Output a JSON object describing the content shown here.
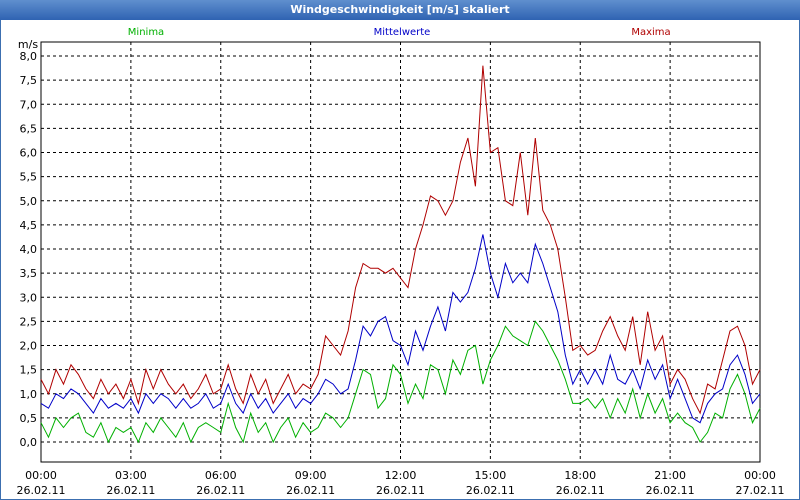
{
  "window": {
    "title": "Windgeschwindigkeit [m/s] skaliert"
  },
  "chart_data": {
    "type": "line",
    "title": "Windgeschwindigkeit [m/s] skaliert",
    "ylabel": "m/s",
    "ylim": [
      0,
      8
    ],
    "grid": true,
    "legend_position": "top",
    "y_ticks": [
      "0,0",
      "0,5",
      "1,0",
      "1,5",
      "2,0",
      "2,5",
      "3,0",
      "3,5",
      "4,0",
      "4,5",
      "5,0",
      "5,5",
      "6,0",
      "6,5",
      "7,0",
      "7,5",
      "8,0"
    ],
    "x_ticks": [
      {
        "time": "00:00",
        "date": "26.02.11"
      },
      {
        "time": "03:00",
        "date": "26.02.11"
      },
      {
        "time": "06:00",
        "date": "26.02.11"
      },
      {
        "time": "09:00",
        "date": "26.02.11"
      },
      {
        "time": "12:00",
        "date": "26.02.11"
      },
      {
        "time": "15:00",
        "date": "26.02.11"
      },
      {
        "time": "18:00",
        "date": "26.02.11"
      },
      {
        "time": "21:00",
        "date": "26.02.11"
      },
      {
        "time": "00:00",
        "date": "27.02.11"
      }
    ],
    "x_hours": [
      0,
      0.25,
      0.5,
      0.75,
      1,
      1.25,
      1.5,
      1.75,
      2,
      2.25,
      2.5,
      2.75,
      3,
      3.25,
      3.5,
      3.75,
      4,
      4.25,
      4.5,
      4.75,
      5,
      5.25,
      5.5,
      5.75,
      6,
      6.25,
      6.5,
      6.75,
      7,
      7.25,
      7.5,
      7.75,
      8,
      8.25,
      8.5,
      8.75,
      9,
      9.25,
      9.5,
      9.75,
      10,
      10.25,
      10.5,
      10.75,
      11,
      11.25,
      11.5,
      11.75,
      12,
      12.25,
      12.5,
      12.75,
      13,
      13.25,
      13.5,
      13.75,
      14,
      14.25,
      14.5,
      14.75,
      15,
      15.25,
      15.5,
      15.75,
      16,
      16.25,
      16.5,
      16.75,
      17,
      17.25,
      17.5,
      17.75,
      18,
      18.25,
      18.5,
      18.75,
      19,
      19.25,
      19.5,
      19.75,
      20,
      20.25,
      20.5,
      20.75,
      21,
      21.25,
      21.5,
      21.75,
      22,
      22.25,
      22.5,
      22.75,
      23,
      23.25,
      23.5,
      23.75,
      24
    ],
    "series": [
      {
        "name": "Minima",
        "color": "#00b000",
        "values": [
          0.4,
          0.1,
          0.5,
          0.3,
          0.5,
          0.6,
          0.2,
          0.1,
          0.4,
          0.0,
          0.3,
          0.2,
          0.3,
          0.0,
          0.4,
          0.2,
          0.5,
          0.3,
          0.1,
          0.4,
          0.0,
          0.3,
          0.4,
          0.3,
          0.2,
          0.8,
          0.3,
          0.0,
          0.6,
          0.2,
          0.4,
          0.0,
          0.3,
          0.5,
          0.1,
          0.4,
          0.2,
          0.3,
          0.6,
          0.5,
          0.3,
          0.5,
          1.0,
          1.5,
          1.4,
          0.7,
          0.9,
          1.6,
          1.4,
          0.8,
          1.2,
          0.9,
          1.6,
          1.5,
          1.0,
          1.7,
          1.4,
          1.9,
          2.0,
          1.2,
          1.7,
          2.0,
          2.4,
          2.2,
          2.1,
          2.0,
          2.5,
          2.3,
          2.0,
          1.7,
          1.3,
          0.8,
          0.8,
          0.9,
          0.7,
          0.9,
          0.5,
          0.9,
          0.6,
          1.1,
          0.5,
          1.0,
          0.6,
          0.9,
          0.4,
          0.6,
          0.4,
          0.3,
          0.0,
          0.2,
          0.6,
          0.5,
          1.1,
          1.4,
          1.0,
          0.4,
          0.7,
          0.5,
          0.5
        ]
      },
      {
        "name": "Mittelwerte",
        "color": "#0000c8",
        "values": [
          0.8,
          0.7,
          1.0,
          0.9,
          1.1,
          1.0,
          0.8,
          0.6,
          0.9,
          0.7,
          0.8,
          0.7,
          0.9,
          0.6,
          1.0,
          0.8,
          1.0,
          0.9,
          0.7,
          0.9,
          0.7,
          0.8,
          1.0,
          0.7,
          0.8,
          1.2,
          0.8,
          0.6,
          1.0,
          0.7,
          0.9,
          0.6,
          0.8,
          1.0,
          0.7,
          0.9,
          0.8,
          1.0,
          1.3,
          1.2,
          1.0,
          1.1,
          1.7,
          2.4,
          2.2,
          2.5,
          2.6,
          2.1,
          2.0,
          1.6,
          2.3,
          1.9,
          2.4,
          2.8,
          2.3,
          3.1,
          2.9,
          3.1,
          3.6,
          4.3,
          3.5,
          3.0,
          3.7,
          3.3,
          3.5,
          3.3,
          4.1,
          3.7,
          3.2,
          2.7,
          1.8,
          1.2,
          1.5,
          1.2,
          1.5,
          1.2,
          1.8,
          1.3,
          1.2,
          1.5,
          1.1,
          1.7,
          1.3,
          1.6,
          0.9,
          1.3,
          0.9,
          0.5,
          0.4,
          0.8,
          1.0,
          1.1,
          1.6,
          1.8,
          1.4,
          0.8,
          1.0,
          0.7,
          1.1
        ]
      },
      {
        "name": "Maxima",
        "color": "#b00000",
        "values": [
          1.3,
          1.0,
          1.5,
          1.2,
          1.6,
          1.4,
          1.1,
          0.9,
          1.3,
          1.0,
          1.2,
          0.9,
          1.3,
          0.8,
          1.5,
          1.1,
          1.5,
          1.2,
          1.0,
          1.2,
          0.9,
          1.1,
          1.4,
          1.0,
          1.1,
          1.6,
          1.1,
          0.8,
          1.4,
          1.0,
          1.3,
          0.8,
          1.1,
          1.4,
          1.0,
          1.2,
          1.1,
          1.4,
          2.2,
          2.0,
          1.8,
          2.3,
          3.2,
          3.7,
          3.6,
          3.6,
          3.5,
          3.6,
          3.4,
          3.2,
          4.0,
          4.5,
          5.1,
          5.0,
          4.7,
          5.0,
          5.8,
          6.3,
          5.3,
          7.8,
          6.0,
          6.1,
          5.0,
          4.9,
          6.0,
          4.7,
          6.3,
          4.8,
          4.5,
          4.0,
          3.0,
          1.9,
          2.0,
          1.8,
          1.9,
          2.3,
          2.6,
          2.2,
          1.9,
          2.6,
          1.6,
          2.7,
          1.9,
          2.2,
          1.2,
          1.5,
          1.3,
          0.9,
          0.6,
          1.2,
          1.1,
          1.7,
          2.3,
          2.4,
          2.0,
          1.2,
          1.5,
          1.1,
          1.0
        ]
      }
    ]
  }
}
